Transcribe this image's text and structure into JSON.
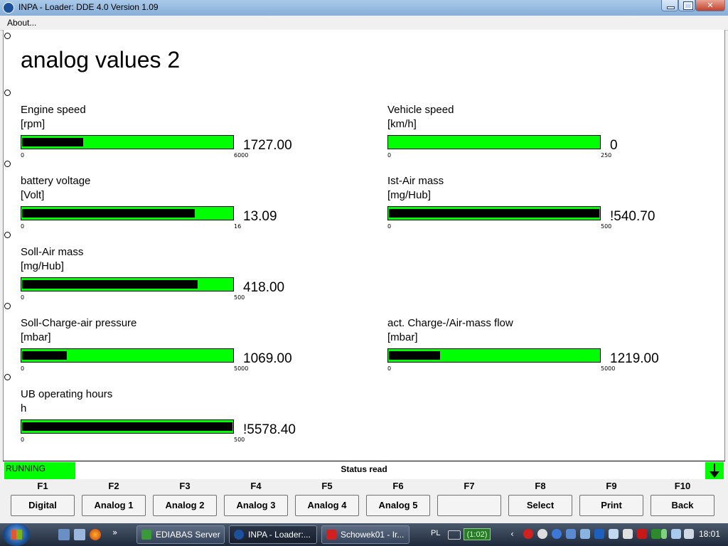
{
  "window": {
    "title": "INPA - Loader:  DDE 4.0 Version 1.09"
  },
  "menu": {
    "about_label": "About..."
  },
  "screen": {
    "heading": "analog values 2"
  },
  "gauges": [
    {
      "name": "Engine speed",
      "unit": "[rpm]",
      "value": "1727.00",
      "min": "0",
      "max": "6000",
      "fill_fraction": 0.29
    },
    {
      "name": "Vehicle speed",
      "unit": "[km/h]",
      "value": "0",
      "min": "0",
      "max": "250",
      "fill_fraction": 0.0
    },
    {
      "name": "battery voltage",
      "unit": "[Volt]",
      "value": "13.09",
      "min": "0",
      "max": "16",
      "fill_fraction": 0.82
    },
    {
      "name": "Ist-Air mass",
      "unit": "[mg/Hub]",
      "value": "!540.70",
      "min": "0",
      "max": "500",
      "fill_fraction": 1.0
    },
    {
      "name": "Soll-Air mass",
      "unit": "[mg/Hub]",
      "value": "418.00",
      "min": "0",
      "max": "500",
      "fill_fraction": 0.836
    },
    {
      "name": "Soll-Charge-air pressure",
      "unit": "[mbar]",
      "value": "1069.00",
      "min": "0",
      "max": "5000",
      "fill_fraction": 0.214
    },
    {
      "name": "act. Charge-/Air-mass flow",
      "unit": "[mbar]",
      "value": "1219.00",
      "min": "0",
      "max": "5000",
      "fill_fraction": 0.244
    },
    {
      "name": "UB operating hours",
      "unit": "h",
      "value": "!5578.40",
      "min": "0",
      "max": "500",
      "fill_fraction": 1.0
    }
  ],
  "status": {
    "state": "RUNNING",
    "text": "Status read"
  },
  "fkeys": [
    {
      "key": "F1",
      "label": "Digital"
    },
    {
      "key": "F2",
      "label": "Analog 1"
    },
    {
      "key": "F3",
      "label": "Analog 2"
    },
    {
      "key": "F4",
      "label": "Analog 3"
    },
    {
      "key": "F5",
      "label": "Analog 4"
    },
    {
      "key": "F6",
      "label": "Analog 5"
    },
    {
      "key": "F7",
      "label": ""
    },
    {
      "key": "F8",
      "label": "Select"
    },
    {
      "key": "F9",
      "label": "Print"
    },
    {
      "key": "F10",
      "label": "Back"
    }
  ],
  "taskbar": {
    "quicklaunch_chevron": "»",
    "tasks": [
      {
        "label": "EDIABAS Server",
        "icon": "ediabas-icon"
      },
      {
        "label": "INPA - Loader:...",
        "icon": "bmw-icon"
      },
      {
        "label": "Schowek01 - Ir...",
        "icon": "irfanview-icon"
      }
    ],
    "tray": {
      "language": "PL",
      "timer": "(1:02)",
      "clock": "18:01"
    }
  },
  "colors": {
    "gauge_green": "#00ff00",
    "gauge_fill": "#000000",
    "status_green": "#00ff00"
  }
}
